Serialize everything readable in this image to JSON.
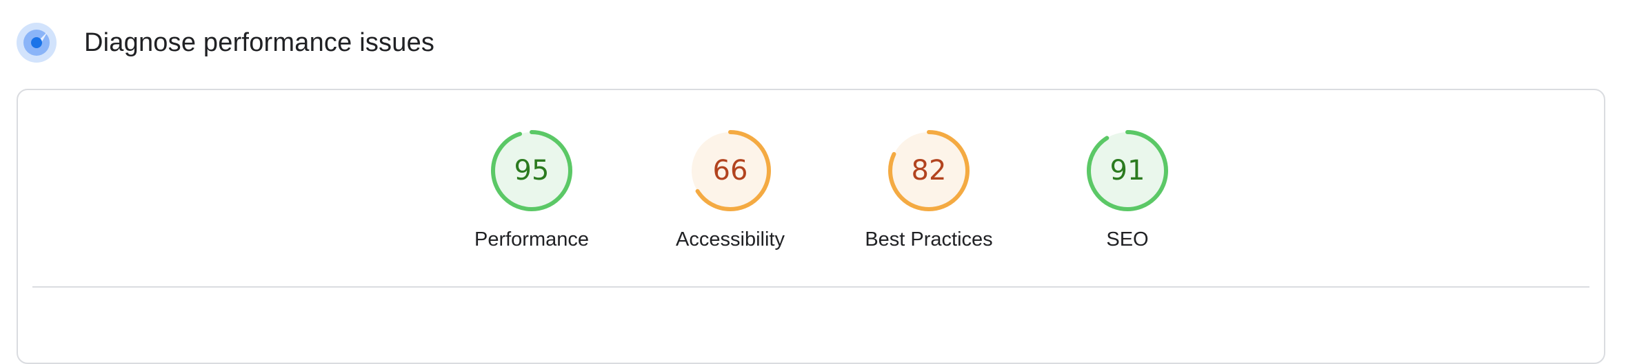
{
  "header": {
    "title": "Diagnose performance issues",
    "icon": "gauge-icon"
  },
  "scores": [
    {
      "category": "Performance",
      "score": 95,
      "status": "good",
      "ring_color": "#5bc866",
      "fill_color": "#eaf7ec",
      "text_color": "#2b7a1f"
    },
    {
      "category": "Accessibility",
      "score": 66,
      "status": "average",
      "ring_color": "#f4aa42",
      "fill_color": "#fdf4e9",
      "text_color": "#b2431e"
    },
    {
      "category": "Best Practices",
      "score": 82,
      "status": "average",
      "ring_color": "#f4aa42",
      "fill_color": "#fdf4e9",
      "text_color": "#b2431e"
    },
    {
      "category": "SEO",
      "score": 91,
      "status": "good",
      "ring_color": "#5bc866",
      "fill_color": "#eaf7ec",
      "text_color": "#2b7a1f"
    }
  ],
  "colors": {
    "accent": "#1a73e8",
    "border": "#dadce0"
  }
}
